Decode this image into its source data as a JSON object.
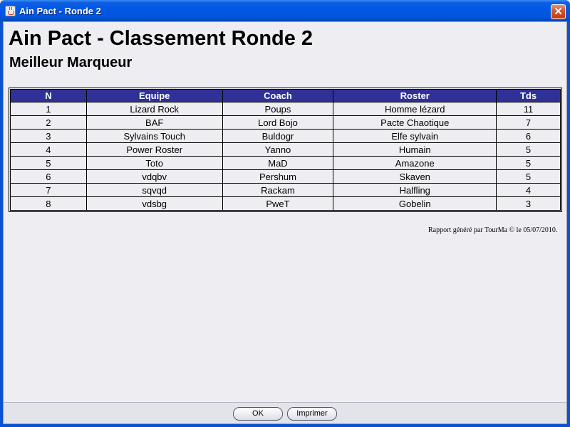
{
  "window": {
    "title": "Ain Pact - Ronde 2",
    "close_label": "✕"
  },
  "report": {
    "title": "Ain Pact - Classement Ronde 2",
    "subtitle": "Meilleur Marqueur",
    "footer": "Rapport généré par TourMa © le 05/07/2010."
  },
  "table": {
    "headers": [
      "N",
      "Equipe",
      "Coach",
      "Roster",
      "Tds"
    ],
    "rows": [
      [
        "1",
        "Lizard Rock",
        "Poups",
        "Homme lézard",
        "11"
      ],
      [
        "2",
        "BAF",
        "Lord Bojo",
        "Pacte Chaotique",
        "7"
      ],
      [
        "3",
        "Sylvains Touch",
        "Buldogr",
        "Elfe sylvain",
        "6"
      ],
      [
        "4",
        "Power Roster",
        "Yanno",
        "Humain",
        "5"
      ],
      [
        "5",
        "Toto",
        "MaD",
        "Amazone",
        "5"
      ],
      [
        "6",
        "vdqbv",
        "Pershum",
        "Skaven",
        "5"
      ],
      [
        "7",
        "sqvqd",
        "Rackam",
        "Halfling",
        "4"
      ],
      [
        "8",
        "vdsbg",
        "PweT",
        "Gobelin",
        "3"
      ]
    ]
  },
  "buttons": {
    "ok": "OK",
    "print": "Imprimer"
  }
}
